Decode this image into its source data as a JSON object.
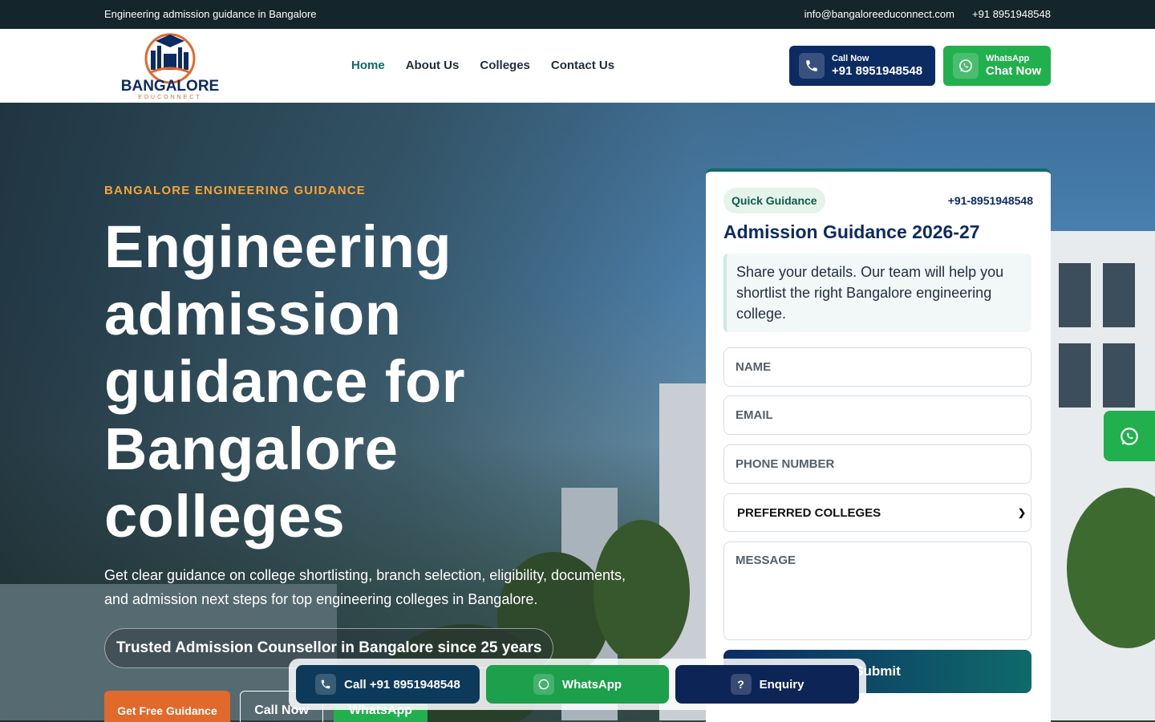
{
  "topbar": {
    "tagline": "Engineering admission guidance in Bangalore",
    "email": "info@bangaloreeduconnect.com",
    "phone": "+91 8951948548"
  },
  "logo": {
    "name": "BANGALORE",
    "sub": "EDUCONNECT"
  },
  "nav": {
    "items": [
      {
        "label": "Home",
        "active": true
      },
      {
        "label": "About Us"
      },
      {
        "label": "Colleges"
      },
      {
        "label": "Contact Us"
      }
    ]
  },
  "header_buttons": {
    "call": {
      "small": "Call Now",
      "big": "+91 8951948548"
    },
    "whatsapp": {
      "small": "WhatsApp",
      "big": "Chat Now"
    }
  },
  "hero": {
    "eyebrow": "BANGALORE ENGINEERING GUIDANCE",
    "title": "Engineering admission guidance for Bangalore colleges",
    "lead": "Get clear guidance on college shortlisting, branch selection, eligibility, documents, and admission next steps for top engineering colleges in Bangalore.",
    "trust": "Trusted Admission Counsellor in Bangalore since 25 years",
    "cta_primary": "Get Free Guidance",
    "cta_call": "Call Now",
    "cta_whatsapp": "WhatsApp"
  },
  "form": {
    "chip": "Quick Guidance",
    "phone": "+91-8951948548",
    "title": "Admission Guidance 2026-27",
    "note": "Share your details. Our team will help you shortlist the right Bangalore engineering college.",
    "name_placeholder": "NAME",
    "email_placeholder": "EMAIL",
    "phone_placeholder": "PHONE NUMBER",
    "select_value": "PREFERRED COLLEGES",
    "message_placeholder": "MESSAGE",
    "submit": "Submit"
  },
  "bottom_bar": {
    "call": "Call +91 8951948548",
    "whatsapp": "WhatsApp",
    "enquiry": "Enquiry"
  },
  "colors": {
    "navy": "#0d2b63",
    "teal": "#0f6a6a",
    "green": "#22b04f",
    "orange": "#e2692c",
    "eyebrow": "#f3a53a"
  }
}
